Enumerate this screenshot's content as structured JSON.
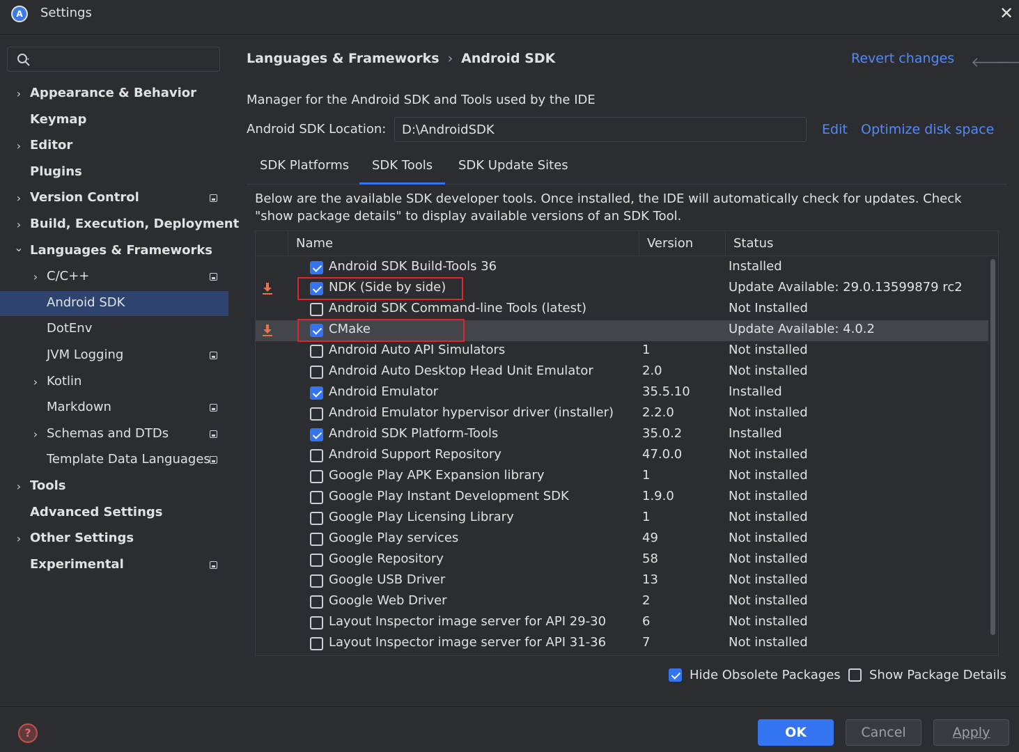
{
  "window": {
    "title": "Settings",
    "logo_letter": "A",
    "close": "✕"
  },
  "sidebar": {
    "search_placeholder": "",
    "items": [
      {
        "label": "Appearance & Behavior",
        "level": 0,
        "bold": true,
        "expandable": true,
        "expanded": false,
        "badge": false
      },
      {
        "label": "Keymap",
        "level": 0,
        "bold": true,
        "expandable": false,
        "badge": false
      },
      {
        "label": "Editor",
        "level": 0,
        "bold": true,
        "expandable": true,
        "expanded": false,
        "badge": false
      },
      {
        "label": "Plugins",
        "level": 0,
        "bold": true,
        "expandable": false,
        "badge": false
      },
      {
        "label": "Version Control",
        "level": 0,
        "bold": true,
        "expandable": true,
        "expanded": false,
        "badge": true
      },
      {
        "label": "Build, Execution, Deployment",
        "level": 0,
        "bold": true,
        "expandable": true,
        "expanded": false,
        "badge": false
      },
      {
        "label": "Languages & Frameworks",
        "level": 0,
        "bold": true,
        "expandable": true,
        "expanded": true,
        "badge": false
      },
      {
        "label": "C/C++",
        "level": 1,
        "bold": false,
        "expandable": true,
        "expanded": false,
        "badge": true
      },
      {
        "label": "Android SDK",
        "level": 1,
        "bold": false,
        "expandable": false,
        "badge": false,
        "selected": true
      },
      {
        "label": "DotEnv",
        "level": 1,
        "bold": false,
        "expandable": false,
        "badge": false
      },
      {
        "label": "JVM Logging",
        "level": 1,
        "bold": false,
        "expandable": false,
        "badge": true
      },
      {
        "label": "Kotlin",
        "level": 1,
        "bold": false,
        "expandable": true,
        "expanded": false,
        "badge": false
      },
      {
        "label": "Markdown",
        "level": 1,
        "bold": false,
        "expandable": false,
        "badge": true
      },
      {
        "label": "Schemas and DTDs",
        "level": 1,
        "bold": false,
        "expandable": true,
        "expanded": false,
        "badge": true
      },
      {
        "label": "Template Data Languages",
        "level": 1,
        "bold": false,
        "expandable": false,
        "badge": true
      },
      {
        "label": "Tools",
        "level": 0,
        "bold": true,
        "expandable": true,
        "expanded": false,
        "badge": false
      },
      {
        "label": "Advanced Settings",
        "level": 0,
        "bold": true,
        "expandable": false,
        "badge": false
      },
      {
        "label": "Other Settings",
        "level": 0,
        "bold": true,
        "expandable": true,
        "expanded": false,
        "badge": false
      },
      {
        "label": "Experimental",
        "level": 0,
        "bold": true,
        "expandable": false,
        "badge": true
      }
    ]
  },
  "header": {
    "breadcrumb_parent": "Languages & Frameworks",
    "breadcrumb_sep": "›",
    "breadcrumb_current": "Android SDK",
    "revert": "Revert changes",
    "back_arrow": "🡐",
    "forward_arrow": "🡒"
  },
  "sdk": {
    "description": "Manager for the Android SDK and Tools used by the IDE",
    "location_label": "Android SDK Location:",
    "location_value": "D:\\AndroidSDK",
    "edit": "Edit",
    "optimize": "Optimize disk space"
  },
  "tabs": [
    {
      "label": "SDK Platforms",
      "active": false
    },
    {
      "label": "SDK Tools",
      "active": true
    },
    {
      "label": "SDK Update Sites",
      "active": false
    }
  ],
  "tab_description": "Below are the available SDK developer tools. Once installed, the IDE will automatically check for updates. Check \"show package details\" to display available versions of an SDK Tool.",
  "table": {
    "columns": {
      "name": "Name",
      "version": "Version",
      "status": "Status"
    },
    "rows": [
      {
        "name": "Android SDK Build-Tools 36",
        "version": "",
        "status": "Installed",
        "checked": true,
        "download": false
      },
      {
        "name": "NDK (Side by side)",
        "version": "",
        "status": "Update Available: 29.0.13599879 rc2",
        "checked": true,
        "download": true,
        "boxed": true
      },
      {
        "name": "Android SDK Command-line Tools (latest)",
        "version": "",
        "status": "Not Installed",
        "checked": false,
        "download": false
      },
      {
        "name": "CMake",
        "version": "",
        "status": "Update Available: 4.0.2",
        "checked": true,
        "download": true,
        "boxed": true,
        "highlight": true
      },
      {
        "name": "Android Auto API Simulators",
        "version": "1",
        "status": "Not installed",
        "checked": false,
        "download": false
      },
      {
        "name": "Android Auto Desktop Head Unit Emulator",
        "version": "2.0",
        "status": "Not installed",
        "checked": false,
        "download": false
      },
      {
        "name": "Android Emulator",
        "version": "35.5.10",
        "status": "Installed",
        "checked": true,
        "download": false
      },
      {
        "name": "Android Emulator hypervisor driver (installer)",
        "version": "2.2.0",
        "status": "Not installed",
        "checked": false,
        "download": false
      },
      {
        "name": "Android SDK Platform-Tools",
        "version": "35.0.2",
        "status": "Installed",
        "checked": true,
        "download": false
      },
      {
        "name": "Android Support Repository",
        "version": "47.0.0",
        "status": "Not installed",
        "checked": false,
        "download": false
      },
      {
        "name": "Google Play APK Expansion library",
        "version": "1",
        "status": "Not installed",
        "checked": false,
        "download": false
      },
      {
        "name": "Google Play Instant Development SDK",
        "version": "1.9.0",
        "status": "Not installed",
        "checked": false,
        "download": false
      },
      {
        "name": "Google Play Licensing Library",
        "version": "1",
        "status": "Not installed",
        "checked": false,
        "download": false
      },
      {
        "name": "Google Play services",
        "version": "49",
        "status": "Not installed",
        "checked": false,
        "download": false
      },
      {
        "name": "Google Repository",
        "version": "58",
        "status": "Not installed",
        "checked": false,
        "download": false
      },
      {
        "name": "Google USB Driver",
        "version": "13",
        "status": "Not installed",
        "checked": false,
        "download": false
      },
      {
        "name": "Google Web Driver",
        "version": "2",
        "status": "Not installed",
        "checked": false,
        "download": false
      },
      {
        "name": "Layout Inspector image server for API 29-30",
        "version": "6",
        "status": "Not installed",
        "checked": false,
        "download": false
      },
      {
        "name": "Layout Inspector image server for API 31-36",
        "version": "7",
        "status": "Not installed",
        "checked": false,
        "download": false
      }
    ]
  },
  "options": {
    "hide_obsolete": {
      "label": "Hide Obsolete Packages",
      "checked": true
    },
    "show_details": {
      "label": "Show Package Details",
      "checked": false
    }
  },
  "footer": {
    "help": "?",
    "ok": "OK",
    "cancel": "Cancel",
    "apply": "Apply"
  },
  "colors": {
    "accent": "#3574f0",
    "link": "#548af7",
    "selection": "#2e436e",
    "download": "#e8734a",
    "highlight_box": "#e3242b"
  }
}
